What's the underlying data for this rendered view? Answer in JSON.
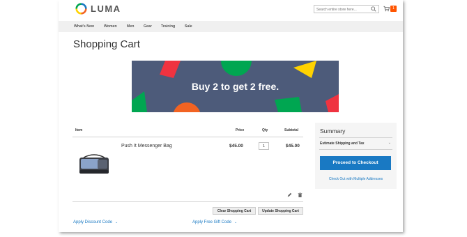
{
  "brand": {
    "name": "LUMA",
    "logo_colors": [
      "#f26322",
      "#ffd200",
      "#00a651",
      "#1979c3"
    ]
  },
  "search": {
    "placeholder": "Search entire store here..."
  },
  "cart": {
    "count": "1"
  },
  "nav": {
    "items": [
      "What's New",
      "Women",
      "Men",
      "Gear",
      "Training",
      "Sale"
    ]
  },
  "page": {
    "title": "Shopping Cart"
  },
  "banner": {
    "text": "Buy 2 to get 2 free."
  },
  "table": {
    "headers": {
      "item": "Item",
      "price": "Price",
      "qty": "Qty",
      "subtotal": "Subtotal"
    },
    "rows": [
      {
        "name": "Push It Messenger Bag",
        "price": "$45.00",
        "qty": "1",
        "subtotal": "$45.00"
      }
    ]
  },
  "actions": {
    "clear": "Clear Shopping Cart",
    "update": "Update Shopping Cart"
  },
  "links": {
    "discount": "Apply Discount Code",
    "gift": "Apply Free Gift Code"
  },
  "summary": {
    "title": "Summary",
    "estimate": "Estimate Shipping and Tax",
    "checkout": "Proceed to Checkout",
    "multiple": "Check Out with Multiple Addresses"
  },
  "colors": {
    "accent": "#1979c3",
    "badge": "#ff5501",
    "banner_bg": "#4d5b7a"
  }
}
